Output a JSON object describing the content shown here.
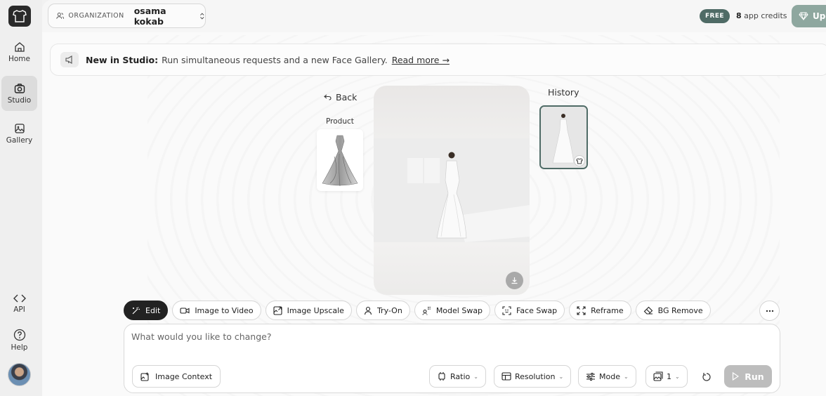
{
  "sidebar": {
    "items": [
      {
        "label": "Home",
        "icon": "home-icon"
      },
      {
        "label": "Studio",
        "icon": "camera-icon",
        "active": true
      },
      {
        "label": "Gallery",
        "icon": "gallery-icon"
      },
      {
        "label": "API",
        "icon": "code-icon"
      },
      {
        "label": "Help",
        "icon": "help-icon"
      }
    ]
  },
  "header": {
    "org_label": "ORGANIZATION",
    "org_name": "osama kokab",
    "plan_badge": "FREE",
    "credits_count": "8",
    "credits_suffix": "app credits",
    "upgrade_label": "Upg"
  },
  "banner": {
    "title": "New in Studio:",
    "text": "Run simultaneous requests and a new Face Gallery.",
    "link": "Read more →"
  },
  "studio": {
    "back_label": "Back",
    "product_label": "Product",
    "history_label": "History"
  },
  "tools": [
    {
      "label": "Edit",
      "icon": "magic-wand-icon",
      "active": true
    },
    {
      "label": "Image to Video",
      "icon": "video-icon"
    },
    {
      "label": "Image Upscale",
      "icon": "upscale-icon"
    },
    {
      "label": "Try-On",
      "icon": "person-icon"
    },
    {
      "label": "Model Swap",
      "icon": "model-swap-icon"
    },
    {
      "label": "Face Swap",
      "icon": "face-icon"
    },
    {
      "label": "Reframe",
      "icon": "expand-icon"
    },
    {
      "label": "BG Remove",
      "icon": "eraser-icon"
    }
  ],
  "prompt": {
    "placeholder": "What would you like to change?",
    "context_label": "Image Context",
    "ratio_label": "Ratio",
    "resolution_label": "Resolution",
    "mode_label": "Mode",
    "count_value": "1",
    "run_label": "Run"
  },
  "colors": {
    "accent": "#4f6b66",
    "upgrade": "#8ea79f",
    "run_disabled": "#bdbdbd"
  }
}
